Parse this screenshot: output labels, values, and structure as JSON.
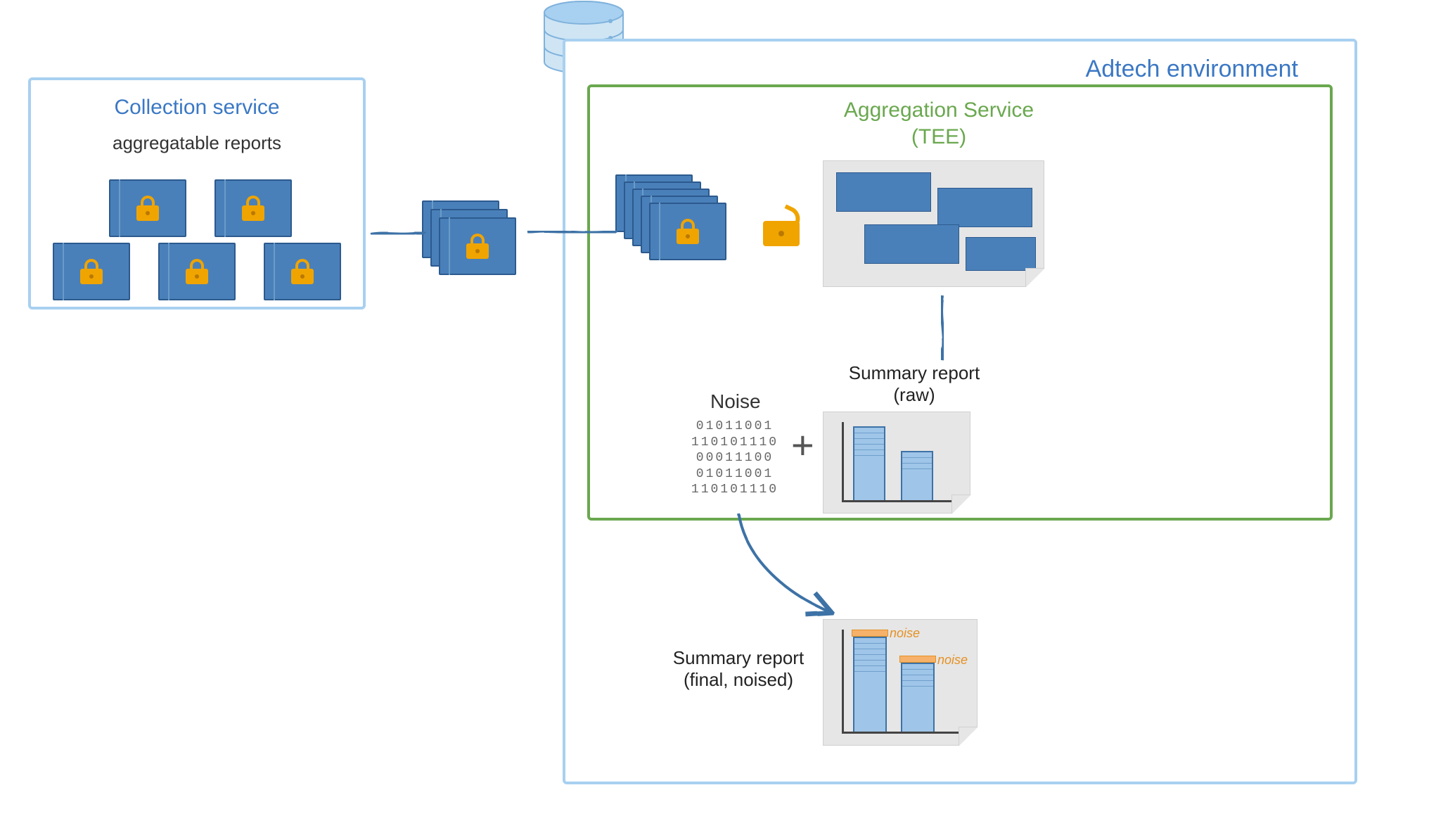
{
  "collection": {
    "title": "Collection service",
    "subtitle": "aggregatable reports"
  },
  "adtech": {
    "title": "Adtech environment"
  },
  "aggregation": {
    "title_line1": "Aggregation Service",
    "title_line2": "(TEE)"
  },
  "noise": {
    "title": "Noise",
    "lines": [
      "01011001",
      "110101110",
      "00011100",
      "01011001",
      "110101110"
    ],
    "plus": "+"
  },
  "summary_raw": {
    "label_line1": "Summary report",
    "label_line2": "(raw)"
  },
  "summary_final": {
    "label_line1": "Summary report",
    "label_line2": "(final, noised)",
    "noise_tag": "noise"
  },
  "colors": {
    "blue_border": "#a8d0f0",
    "blue_fill": "#4a80b9",
    "blue_title": "#3b78c4",
    "green": "#6aa84f",
    "lock": "#f0a400",
    "arrow": "#3d72a6",
    "noise_cap": "#f6b26b"
  }
}
